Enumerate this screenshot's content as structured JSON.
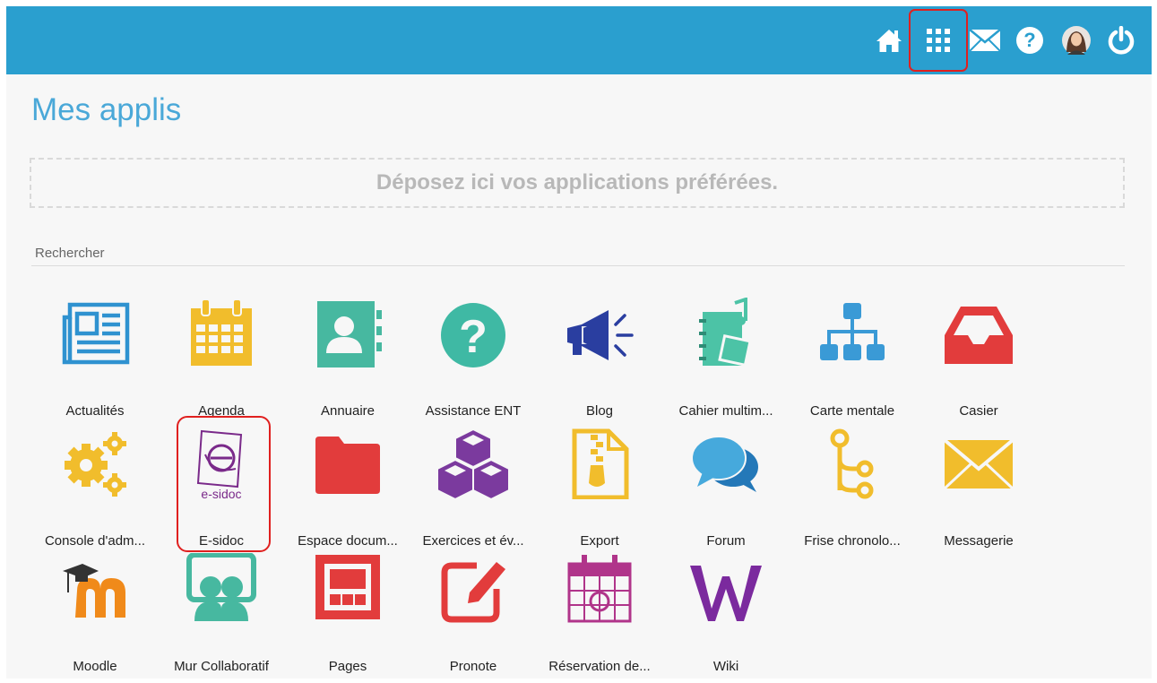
{
  "colors": {
    "topbar": "#2a9fcf",
    "title": "#4aa8d8",
    "highlight": "#e0201f"
  },
  "topbar": {
    "icons": [
      "home-icon",
      "apps-grid-icon",
      "mail-icon",
      "help-icon",
      "avatar",
      "power-icon"
    ]
  },
  "page": {
    "title": "Mes applis",
    "dropzone": "Déposez ici vos applications préférées.",
    "search_placeholder": "Rechercher"
  },
  "apps": [
    {
      "label": "Actualités",
      "icon": "newspaper-icon"
    },
    {
      "label": "Agenda",
      "icon": "calendar-icon"
    },
    {
      "label": "Annuaire",
      "icon": "address-book-icon"
    },
    {
      "label": "Assistance ENT",
      "icon": "help-circle-icon"
    },
    {
      "label": "Blog",
      "icon": "megaphone-icon"
    },
    {
      "label": "Cahier multim...",
      "icon": "notebook-media-icon"
    },
    {
      "label": "Carte mentale",
      "icon": "sitemap-icon"
    },
    {
      "label": "Casier",
      "icon": "inbox-tray-icon"
    },
    {
      "label": "Console d'adm...",
      "icon": "gears-icon"
    },
    {
      "label": "E-sidoc",
      "icon": "esidoc-logo-icon"
    },
    {
      "label": "Espace docum...",
      "icon": "folder-icon"
    },
    {
      "label": "Exercices et év...",
      "icon": "cubes-icon"
    },
    {
      "label": "Export",
      "icon": "zip-file-icon"
    },
    {
      "label": "Forum",
      "icon": "chat-bubbles-icon"
    },
    {
      "label": "Frise chronolo...",
      "icon": "timeline-icon"
    },
    {
      "label": "Messagerie",
      "icon": "envelope-icon"
    },
    {
      "label": "Moodle",
      "icon": "moodle-icon"
    },
    {
      "label": "Mur Collaboratif",
      "icon": "board-icon"
    },
    {
      "label": "Pages",
      "icon": "pages-icon"
    },
    {
      "label": "Pronote",
      "icon": "edit-pencil-icon"
    },
    {
      "label": "Réservation de...",
      "icon": "booking-calendar-icon"
    },
    {
      "label": "Wiki",
      "icon": "wikipedia-icon"
    }
  ],
  "esidoc_logo_text": "e-sidoc"
}
